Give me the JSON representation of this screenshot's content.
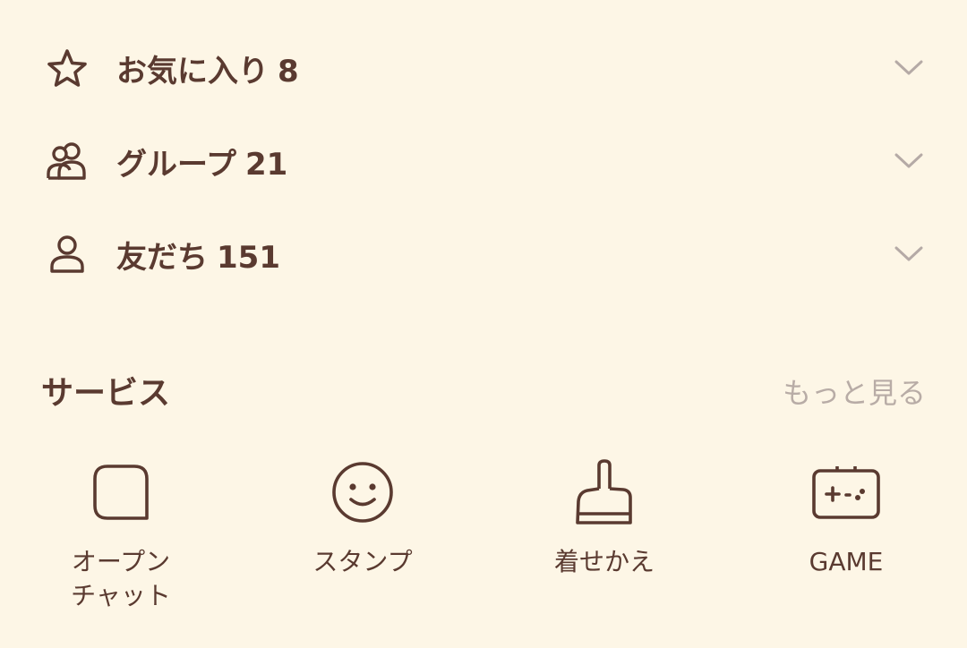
{
  "lists": [
    {
      "icon": "star-icon",
      "label": "お気に入り",
      "count": "8"
    },
    {
      "icon": "group-icon",
      "label": "グループ",
      "count": "21"
    },
    {
      "icon": "friend-icon",
      "label": "友だち",
      "count": "151"
    }
  ],
  "services": {
    "title": "サービス",
    "more": "もっと見る",
    "items": [
      {
        "icon": "open-chat-icon",
        "label_line1": "オープン",
        "label_line2": "チャット"
      },
      {
        "icon": "smiley-icon",
        "label_line1": "スタンプ",
        "label_line2": ""
      },
      {
        "icon": "brush-icon",
        "label_line1": "着せかえ",
        "label_line2": ""
      },
      {
        "icon": "gamepad-icon",
        "label_line1": "GAME",
        "label_line2": ""
      }
    ]
  },
  "colors": {
    "background": "#fdf6e6",
    "text": "#5a3a30",
    "muted": "#b8aca6",
    "chevron": "#b5aaa6"
  }
}
